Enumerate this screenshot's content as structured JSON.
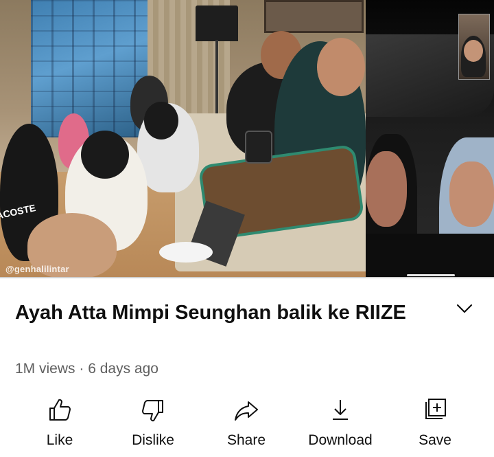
{
  "video": {
    "watermark": "@genhalilintar",
    "shirt_text": "ACOSTE"
  },
  "title": "Ayah Atta Mimpi Seunghan balik ke RIIZE",
  "meta": {
    "views": "1M views",
    "separator": " · ",
    "age": "6 days ago"
  },
  "actions": [
    {
      "label": "Like",
      "icon": "thumbs-up-icon"
    },
    {
      "label": "Dislike",
      "icon": "thumbs-down-icon"
    },
    {
      "label": "Share",
      "icon": "share-arrow-icon"
    },
    {
      "label": "Download",
      "icon": "download-icon"
    },
    {
      "label": "Save",
      "icon": "save-to-playlist-icon"
    }
  ]
}
